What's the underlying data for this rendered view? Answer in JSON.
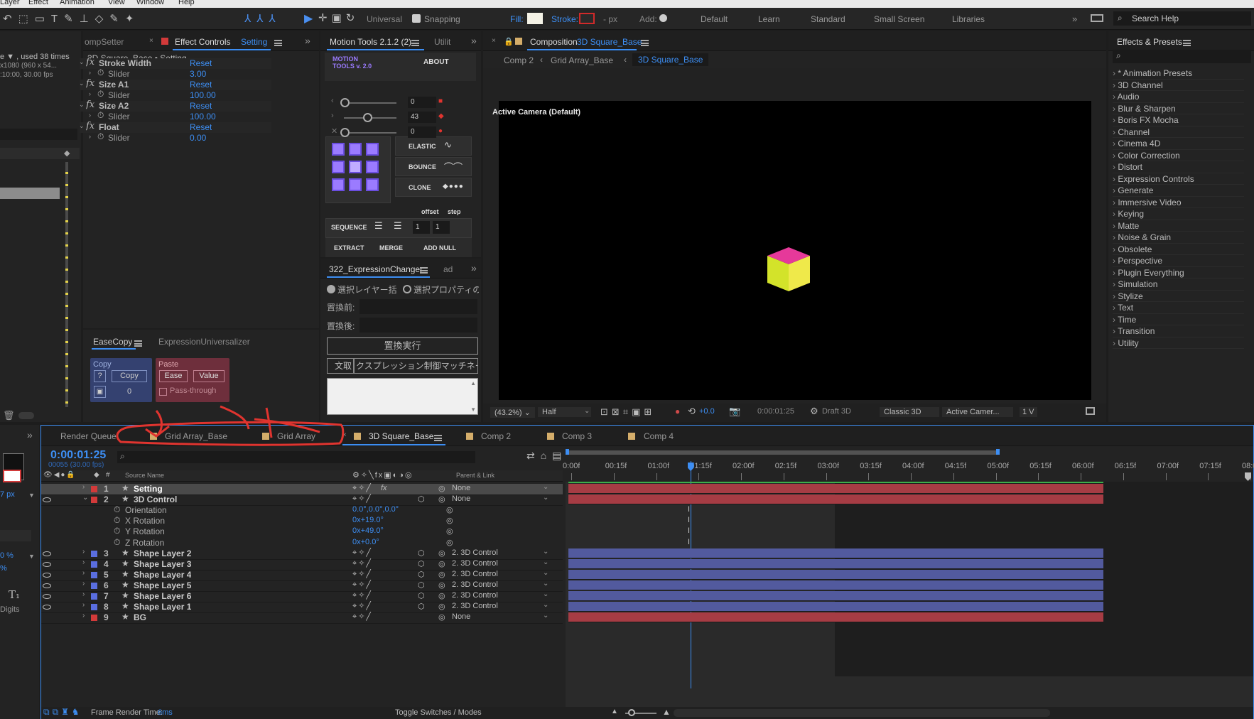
{
  "menubar": {
    "items": [
      "Layer",
      "Effect",
      "Animation",
      "View",
      "Window",
      "Help"
    ]
  },
  "toolbar": {
    "universal_label": "Universal",
    "snapping_label": "Snapping",
    "fill_label": "Fill:",
    "stroke_label": "Stroke:",
    "stroke_unit": "- px",
    "add_label": "Add:",
    "workspaces": [
      "Default",
      "Learn",
      "Standard",
      "Small Screen",
      "Libraries"
    ],
    "search_placeholder": "Search Help",
    "fill_color": "#f4f2e6",
    "stroke_color": "#d12a2a"
  },
  "left_project": {
    "line1": "e ▼ , used 38 times",
    "line2": "x1080  (960 x 54...",
    "line3": ":10:00, 30.00 fps"
  },
  "effect_controls": {
    "tab_left": "ompSetter",
    "tab_title": "Effect Controls",
    "tab_layer": "Setting",
    "subtitle": "3D Square_Base • Setting",
    "effects": [
      {
        "name": "Stroke Width",
        "reset": "Reset",
        "param": "Slider",
        "value": "3.00"
      },
      {
        "name": "Size A1",
        "reset": "Reset",
        "param": "Slider",
        "value": "100.00"
      },
      {
        "name": "Size A2",
        "reset": "Reset",
        "param": "Slider",
        "value": "100.00"
      },
      {
        "name": "Float",
        "reset": "Reset",
        "param": "Slider",
        "value": "0.00"
      }
    ]
  },
  "motion_tools": {
    "tab": "Motion Tools 2.1.2 (2)",
    "tab2": "Utilit",
    "logo_line1": "MOTION",
    "logo_line2": "TOOLS v. 2.0",
    "about": "ABOUT",
    "slider_values": [
      "0",
      "43",
      "0"
    ],
    "elastic": "ELASTIC",
    "bounce": "BOUNCE",
    "clone": "CLONE",
    "offset": "offset",
    "step": "step",
    "sequence": "SEQUENCE",
    "seq_values": [
      "1",
      "1"
    ],
    "extract": "EXTRACT",
    "merge": "MERGE",
    "add_null": "ADD NULL"
  },
  "expression_changer": {
    "tab": "322_ExpressionChanger",
    "tab2": "ad",
    "radio1": "選択レイヤー括",
    "radio2": "選択プロパティの",
    "before_label": "置換前:",
    "after_label": "置換後:",
    "run_button": "置換実行",
    "row_btn1": "文取",
    "row_btn2": "クスプレッション制御マッチネーム"
  },
  "easecopy": {
    "tab": "EaseCopy",
    "tab2": "ExpressionUniversalizer",
    "copy_label": "Copy",
    "copy_q": "?",
    "copy_btn": "Copy",
    "copy_count": "0",
    "paste_label": "Paste",
    "ease_btn": "Ease",
    "value_btn": "Value",
    "passthrough": "Pass-through"
  },
  "composition": {
    "tab_prefix": "Composition",
    "tab_name": "3D Square_Base",
    "breadcrumbs": [
      "Comp 2",
      "Grid Array_Base",
      "3D Square_Base"
    ],
    "camera_label": "Active Camera (Default)",
    "footer": {
      "zoom": "(43.2%)",
      "resolution": "Half",
      "exposure": "+0.0",
      "timecode": "0:00:01:25",
      "draft": "Draft 3D",
      "renderer": "Classic 3D",
      "camera": "Active Camer...",
      "views": "1 V"
    }
  },
  "effects_presets": {
    "title": "Effects & Presets",
    "items": [
      "* Animation Presets",
      "3D Channel",
      "Audio",
      "Blur & Sharpen",
      "Boris FX Mocha",
      "Channel",
      "Cinema 4D",
      "Color Correction",
      "Distort",
      "Expression Controls",
      "Generate",
      "Immersive Video",
      "Keying",
      "Matte",
      "Noise & Grain",
      "Obsolete",
      "Perspective",
      "Plugin Everything",
      "Simulation",
      "Stylize",
      "Text",
      "Time",
      "Transition",
      "Utility"
    ]
  },
  "left_strip": {
    "labels": [
      "7 px",
      "0 %",
      "%",
      "Digits"
    ]
  },
  "timeline": {
    "tabs": [
      "Render Queue",
      "Grid Array_Base",
      "Grid Array",
      "3D Square_Base",
      "Comp 2",
      "Comp 3",
      "Comp 4"
    ],
    "timecode": "0:00:01:25",
    "frames": "00055 (30.00 fps)",
    "col_source": "Source Name",
    "col_parent": "Parent & Link",
    "ruler": [
      "0:00f",
      "00:15f",
      "01:00f",
      "01:15f",
      "02:00f",
      "02:15f",
      "03:00f",
      "03:15f",
      "04:00f",
      "04:15f",
      "05:00f",
      "05:15f",
      "06:00f",
      "06:15f",
      "07:00f",
      "07:15f",
      "08:0"
    ],
    "playhead_fraction": 0.232,
    "work_area_end_fraction": 0.502,
    "layers": [
      {
        "num": "1",
        "name": "Setting",
        "color": "#d23a3a",
        "parent": "None",
        "fx": "fx"
      },
      {
        "num": "2",
        "name": "3D Control",
        "color": "#d23a3a",
        "parent": "None",
        "fx": ""
      },
      {
        "num": "3",
        "name": "Shape Layer 2",
        "color": "#5a6ee0",
        "parent": "2. 3D Control",
        "fx": ""
      },
      {
        "num": "4",
        "name": "Shape Layer 3",
        "color": "#5a6ee0",
        "parent": "2. 3D Control",
        "fx": ""
      },
      {
        "num": "5",
        "name": "Shape Layer 4",
        "color": "#5a6ee0",
        "parent": "2. 3D Control",
        "fx": ""
      },
      {
        "num": "6",
        "name": "Shape Layer 5",
        "color": "#5a6ee0",
        "parent": "2. 3D Control",
        "fx": ""
      },
      {
        "num": "7",
        "name": "Shape Layer 6",
        "color": "#5a6ee0",
        "parent": "2. 3D Control",
        "fx": ""
      },
      {
        "num": "8",
        "name": "Shape Layer 1",
        "color": "#5a6ee0",
        "parent": "2. 3D Control",
        "fx": ""
      },
      {
        "num": "9",
        "name": "BG",
        "color": "#d23a3a",
        "parent": "None",
        "fx": ""
      }
    ],
    "props": [
      {
        "name": "Orientation",
        "value": "0.0°,0.0°,0.0°"
      },
      {
        "name": "X Rotation",
        "value": "0x+19.0°"
      },
      {
        "name": "Y Rotation",
        "value": "0x+49.0°"
      },
      {
        "name": "Z Rotation",
        "value": "0x+0.0°"
      }
    ],
    "footer_label": "Frame Render Time:",
    "footer_value": "6ms",
    "toggle": "Toggle Switches / Modes"
  }
}
